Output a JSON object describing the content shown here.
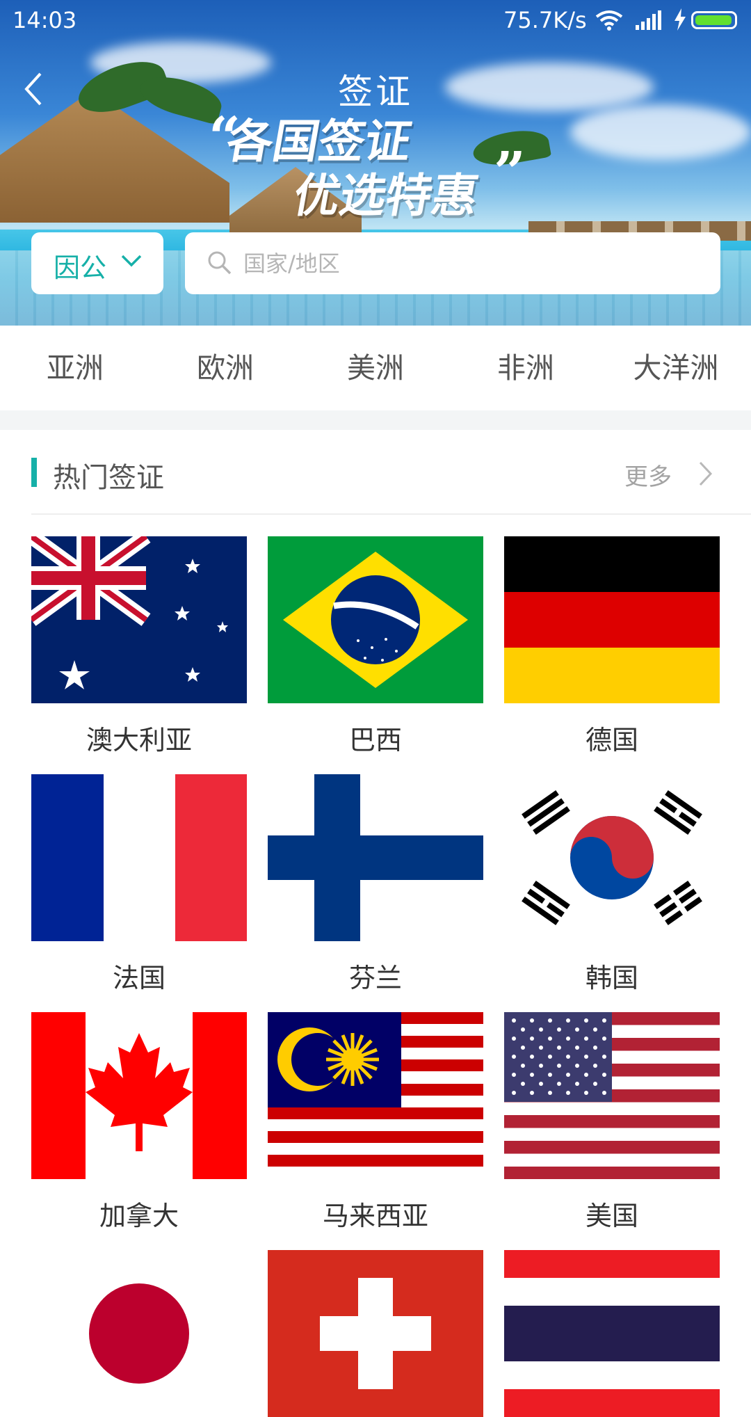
{
  "status_bar": {
    "time": "14:03",
    "network_speed": "75.7K/s",
    "battery_color": "#62e02f"
  },
  "header": {
    "title": "签证",
    "slogan_line1": "各国签证",
    "slogan_line2": "优选特惠"
  },
  "search": {
    "type_label": "因公",
    "placeholder": "国家/地区"
  },
  "tabs": [
    {
      "label": "亚洲"
    },
    {
      "label": "欧洲"
    },
    {
      "label": "美洲"
    },
    {
      "label": "非洲"
    },
    {
      "label": "大洋洲"
    }
  ],
  "hot_visa": {
    "title": "热门签证",
    "more": "更多",
    "accent": "#16b0a8",
    "countries": [
      {
        "name": "澳大利亚",
        "flag": "australia-flag-icon"
      },
      {
        "name": "巴西",
        "flag": "brazil-flag-icon"
      },
      {
        "name": "德国",
        "flag": "germany-flag-icon"
      },
      {
        "name": "法国",
        "flag": "france-flag-icon"
      },
      {
        "name": "芬兰",
        "flag": "finland-flag-icon"
      },
      {
        "name": "韩国",
        "flag": "korea-flag-icon"
      },
      {
        "name": "加拿大",
        "flag": "canada-flag-icon"
      },
      {
        "name": "马来西亚",
        "flag": "malaysia-flag-icon"
      },
      {
        "name": "美国",
        "flag": "usa-flag-icon"
      },
      {
        "name": "",
        "flag": "japan-flag-icon"
      },
      {
        "name": "",
        "flag": "switzerland-flag-icon"
      },
      {
        "name": "",
        "flag": "thailand-flag-icon"
      }
    ]
  }
}
